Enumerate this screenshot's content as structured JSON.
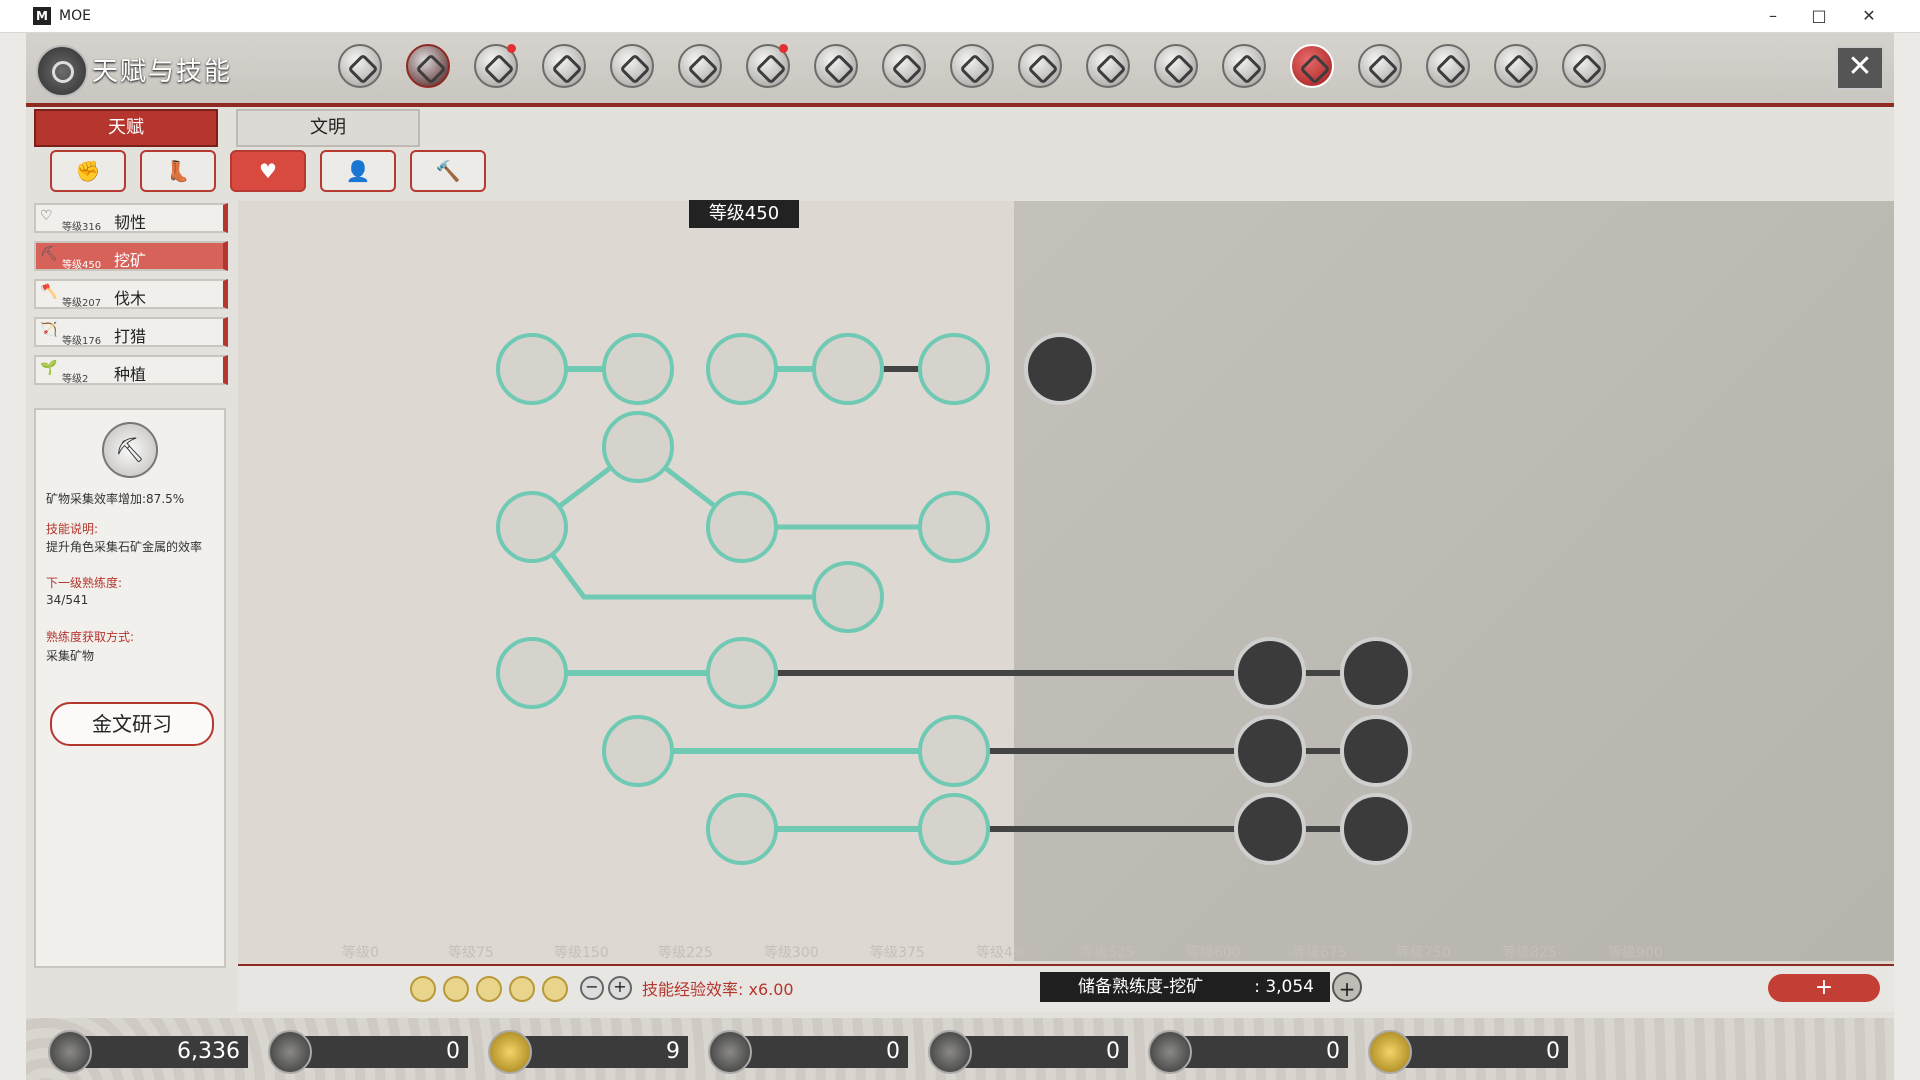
{
  "window": {
    "app_title": "MOE",
    "app_icon": "M",
    "minimize": "–",
    "maximize": "□",
    "close": "✕"
  },
  "header": {
    "title": "天赋与技能",
    "close_glyph": "✕",
    "icons": [
      "talent-helmet-icon",
      "skills-icon",
      "horse-icon",
      "shield-icon",
      "bird-icon",
      "medal-icon",
      "face-icon",
      "dragon-icon",
      "map-icon",
      "scroll-icon",
      "book-icon",
      "family-icon",
      "altar-icon",
      "gear-icon",
      "stack-icon",
      "beast-icon",
      "codex-icon",
      "quill-icon",
      "sword-icon"
    ]
  },
  "tabs": {
    "talent": "天赋",
    "civilization": "文明"
  },
  "subtabs": [
    "✊",
    "👢",
    "♥",
    "👤",
    "🔨"
  ],
  "skills": [
    {
      "name": "韧性",
      "level": "等级316",
      "icon": "♡"
    },
    {
      "name": "挖矿",
      "level": "等级450",
      "icon": "⛏"
    },
    {
      "name": "伐木",
      "level": "等级207",
      "icon": "🪓"
    },
    {
      "name": "打猎",
      "level": "等级176",
      "icon": "🏹"
    },
    {
      "name": "种植",
      "level": "等级2",
      "icon": "🌱"
    }
  ],
  "detail": {
    "icon": "⛏",
    "effect": "矿物采集效率增加:87.5%",
    "desc_label": "技能说明:",
    "desc": "提升角色采集石矿金属的效率",
    "next_label": "下一级熟练度:",
    "next_value": "34/541",
    "source_label": "熟练度获取方式:",
    "source_value": "采集矿物",
    "study_button": "金文研习"
  },
  "tree": {
    "level_banner": "等级450",
    "tiers": [
      "等级0",
      "等级75",
      "等级150",
      "等级225",
      "等级300",
      "等级375",
      "等级450",
      "等级525",
      "等级600",
      "等级675",
      "等级750",
      "等级825",
      "等级900"
    ]
  },
  "treebar": {
    "bonus": "技能经验效率: x6.00",
    "reserve_label": "储备熟练度-挖矿",
    "reserve_value": ": 3,054",
    "minus": "−",
    "plus": "+",
    "red_plus": "+"
  },
  "resources": [
    {
      "icon": "coin-icon",
      "value": "6,336"
    },
    {
      "icon": "pillar-icon",
      "value": "0"
    },
    {
      "icon": "spiral-icon",
      "value": "9"
    },
    {
      "icon": "cluster-icon",
      "value": "0"
    },
    {
      "icon": "cycle-icon",
      "value": "0"
    },
    {
      "icon": "anvil-icon",
      "value": "0"
    },
    {
      "icon": "gold-coin-icon",
      "value": "0"
    }
  ]
}
